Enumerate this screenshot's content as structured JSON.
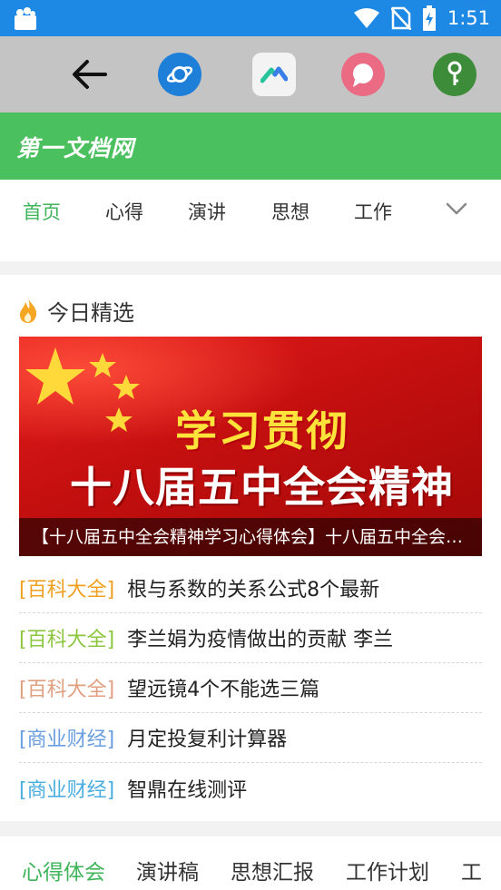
{
  "status_bar": {
    "time": "1:51",
    "icons": [
      "shopping-bag-icon",
      "wifi-icon",
      "no-sim-icon",
      "battery-charging-icon"
    ],
    "background": "#1e88e5"
  },
  "toolbar": {
    "icons": [
      "back-arrow-icon",
      "planet-browser-icon",
      "maps-app-icon",
      "chat-heart-icon",
      "key-icon"
    ]
  },
  "site": {
    "title": "第一文档网",
    "accent": "#4bc05f"
  },
  "nav_tabs": [
    {
      "label": "首页",
      "active": true
    },
    {
      "label": "心得",
      "active": false
    },
    {
      "label": "演讲",
      "active": false
    },
    {
      "label": "思想",
      "active": false
    },
    {
      "label": "工作",
      "active": false
    }
  ],
  "featured": {
    "section_title": "今日精选",
    "banner_line1": "学习贯彻",
    "banner_line2": "十八届五中全会精神",
    "banner_caption": "【十八届五中全会精神学习心得体会】十八届五中全会精神学习心得体会"
  },
  "articles": [
    {
      "tag": "[百科大全]",
      "title": "根与系数的关系公式8个最新",
      "tag_color": "#f0a020"
    },
    {
      "tag": "[百科大全]",
      "title": "李兰娟为疫情做出的贡献 李兰",
      "tag_color": "#8cc63f"
    },
    {
      "tag": "[百科大全]",
      "title": "望远镜4个不能选三篇",
      "tag_color": "#e0a080"
    },
    {
      "tag": "[商业财经]",
      "title": "月定投复利计算器",
      "tag_color": "#6a9ee0"
    },
    {
      "tag": "[商业财经]",
      "title": "智鼎在线测评",
      "tag_color": "#4aaee0"
    }
  ],
  "bottom_tabs": [
    {
      "label": "心得体会",
      "active": true
    },
    {
      "label": "演讲稿",
      "active": false
    },
    {
      "label": "思想汇报",
      "active": false
    },
    {
      "label": "工作计划",
      "active": false
    },
    {
      "label": "工",
      "active": false
    }
  ]
}
